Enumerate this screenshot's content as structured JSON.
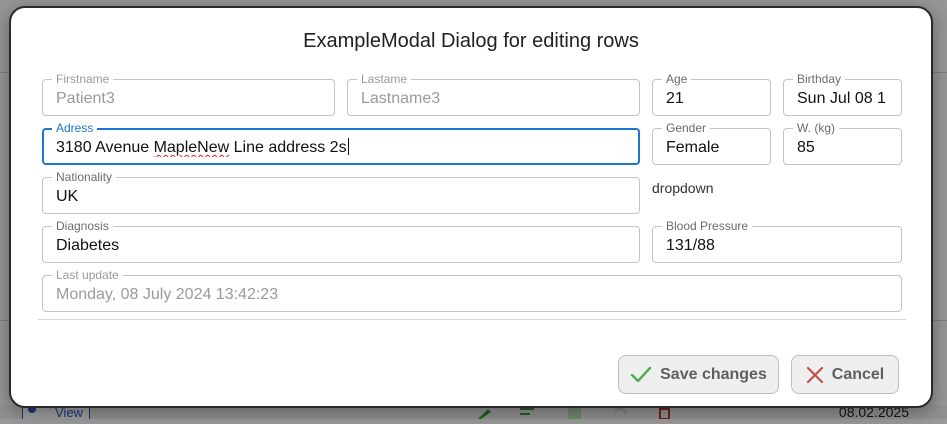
{
  "background": {
    "view_link": "View",
    "date": "08.02.2025"
  },
  "modal": {
    "title": "ExampleModal Dialog for editing rows",
    "fields": {
      "firstname": {
        "label": "Firstname",
        "value": "Patient3"
      },
      "lastname": {
        "label": "Lastame",
        "value": "Lastname3"
      },
      "age": {
        "label": "Age",
        "value": "21"
      },
      "birthday": {
        "label": "Birthday",
        "value": "Sun Jul 08 1"
      },
      "address": {
        "label": "Adress",
        "value_before": "3180 Avenue ",
        "value_misspelled": "MapleNew",
        "value_after": " Line address 2s"
      },
      "gender": {
        "label": "Gender",
        "value": "Female"
      },
      "weight": {
        "label": "W. (kg)",
        "value": "85"
      },
      "nationality": {
        "label": "Nationality",
        "value": "UK"
      },
      "diagnosis": {
        "label": "Diagnosis",
        "value": "Diabetes"
      },
      "blood_pressure": {
        "label": "Blood Pressure",
        "value": "131/88"
      },
      "last_update": {
        "label": "Last update",
        "value": "Monday, 08 July 2024 13:42:23"
      }
    },
    "dropdown_text": "dropdown",
    "buttons": {
      "save": {
        "label": "Save changes",
        "icon": "check-icon"
      },
      "cancel": {
        "label": "Cancel",
        "icon": "close-icon"
      }
    },
    "colors": {
      "focus": "#1976d2",
      "check": "#4caf50",
      "cancel_x": "#c0504d"
    }
  }
}
